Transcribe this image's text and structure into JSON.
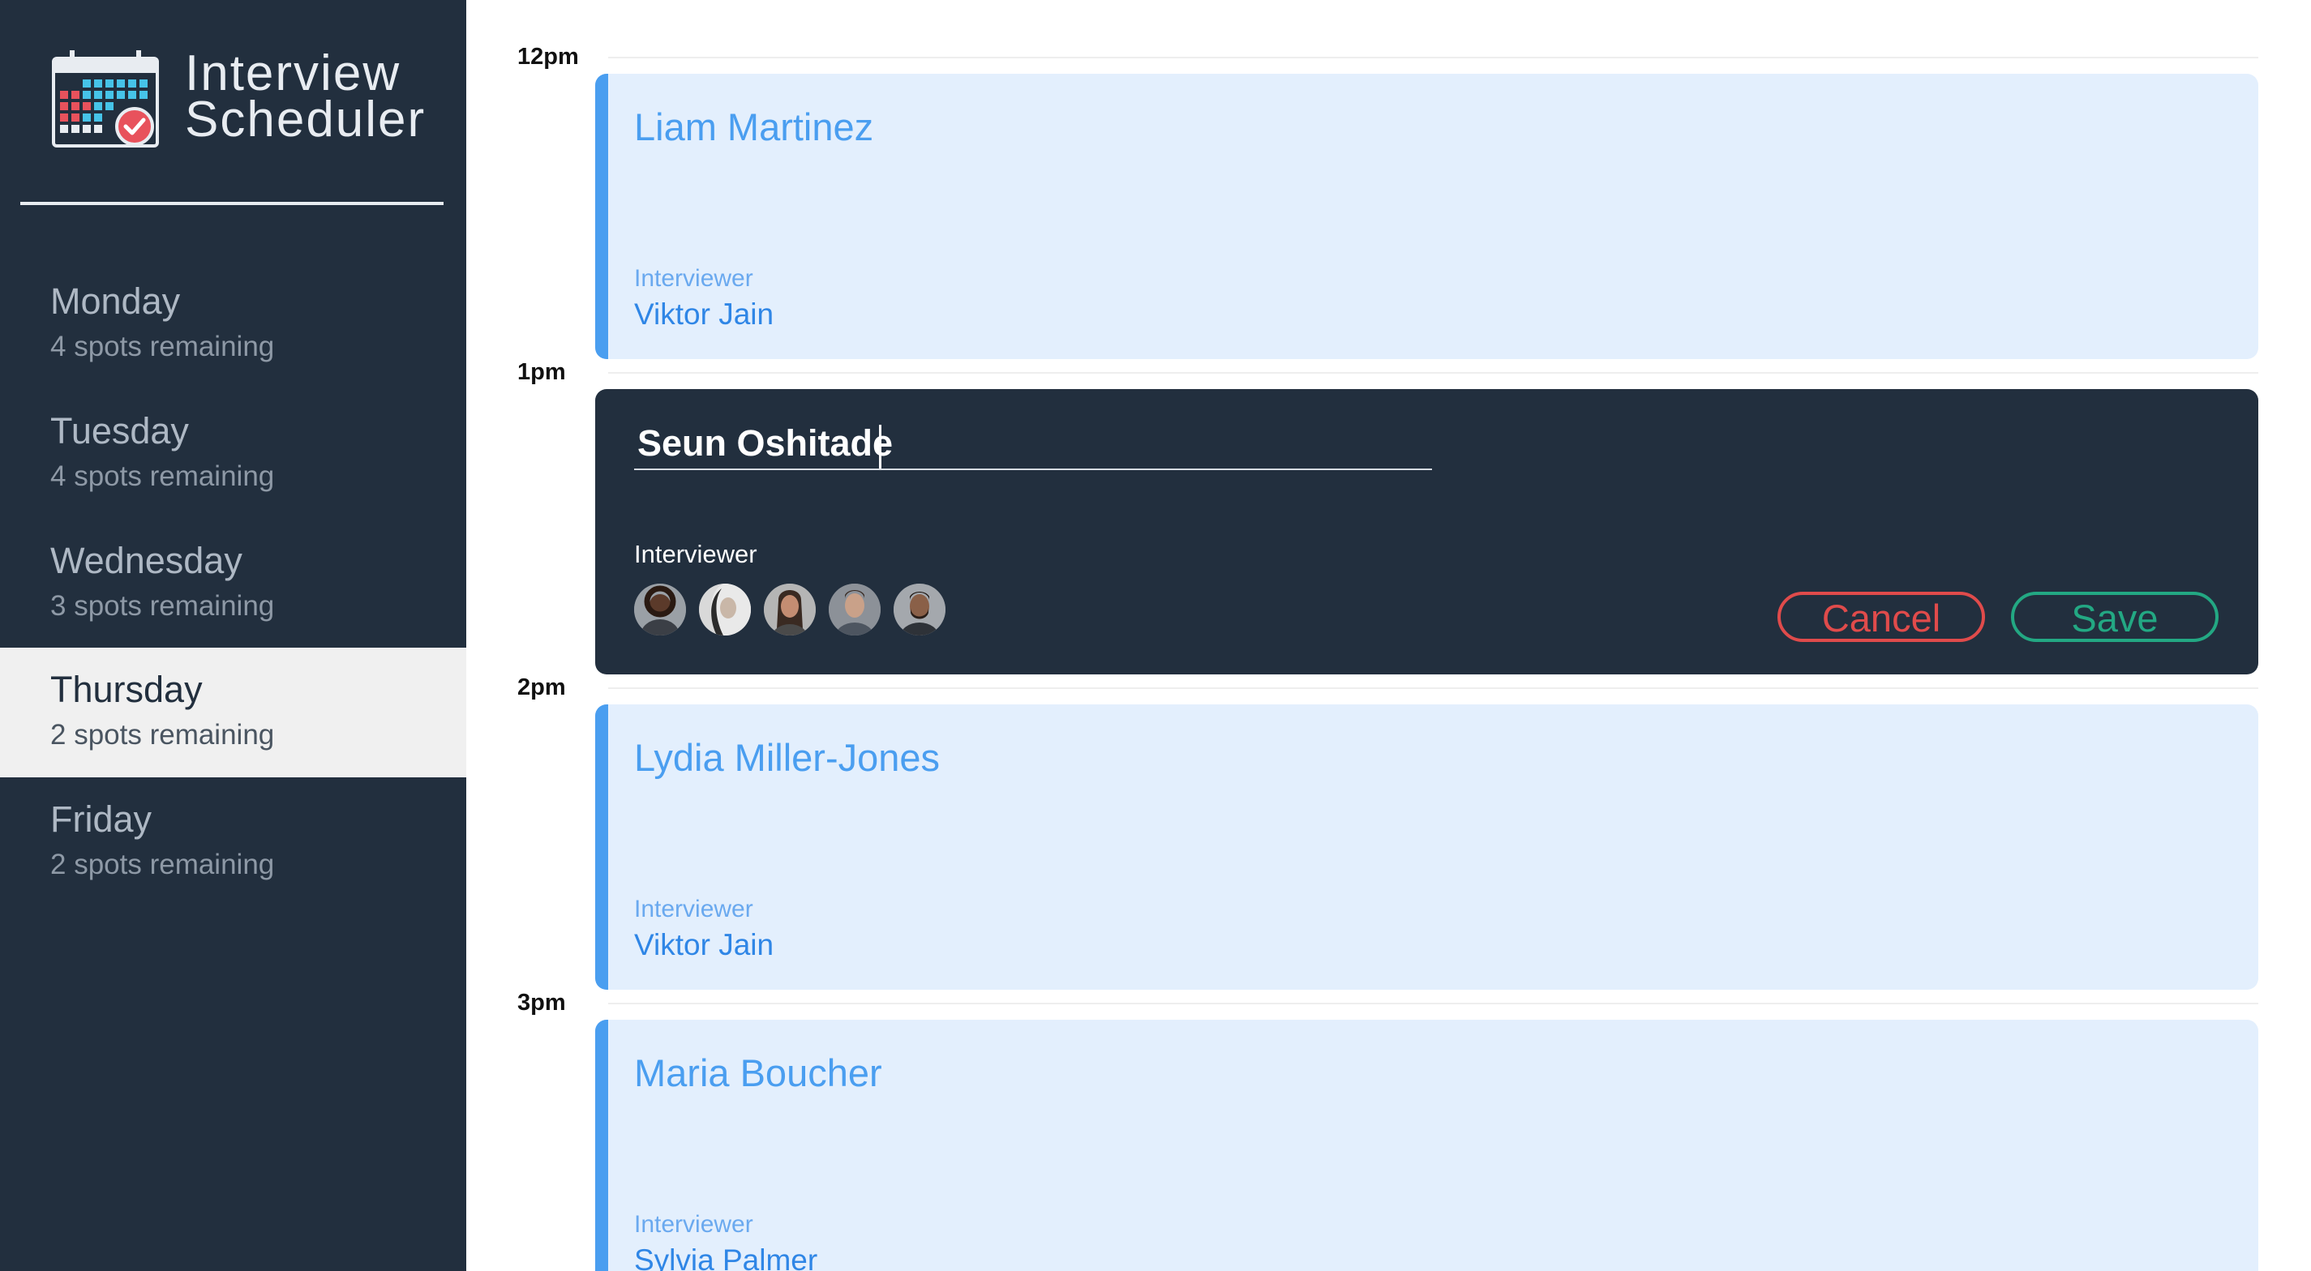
{
  "app": {
    "title_line1": "Interview",
    "title_line2": "Scheduler"
  },
  "sidebar": {
    "days": [
      {
        "name": "Monday",
        "spots": "4 spots remaining",
        "selected": false
      },
      {
        "name": "Tuesday",
        "spots": "4 spots remaining",
        "selected": false
      },
      {
        "name": "Wednesday",
        "spots": "3 spots remaining",
        "selected": false
      },
      {
        "name": "Thursday",
        "spots": "2 spots remaining",
        "selected": true
      },
      {
        "name": "Friday",
        "spots": "2 spots remaining",
        "selected": false
      }
    ]
  },
  "schedule": {
    "times": [
      "12pm",
      "1pm",
      "2pm",
      "3pm"
    ],
    "appointments": [
      {
        "student": "Liam Martinez",
        "interviewer_caption": "Interviewer",
        "interviewer": "Viktor Jain"
      },
      {
        "student": "Lydia Miller-Jones",
        "interviewer_caption": "Interviewer",
        "interviewer": "Viktor Jain"
      },
      {
        "student": "Maria Boucher",
        "interviewer_caption": "Interviewer",
        "interviewer": "Sylvia Palmer"
      }
    ],
    "edit_form": {
      "student_value": "Seun Oshitade",
      "interviewer_caption": "Interviewer",
      "avatars": [
        "avatar-1",
        "avatar-2",
        "avatar-3",
        "avatar-4",
        "avatar-5"
      ],
      "cancel_label": "Cancel",
      "save_label": "Save"
    }
  },
  "colors": {
    "sidebar_bg": "#222f3e",
    "card_bg": "#e3effd",
    "accent_blue": "#4a9ef0",
    "cancel_red": "#e04b4b",
    "save_green": "#23a883"
  }
}
